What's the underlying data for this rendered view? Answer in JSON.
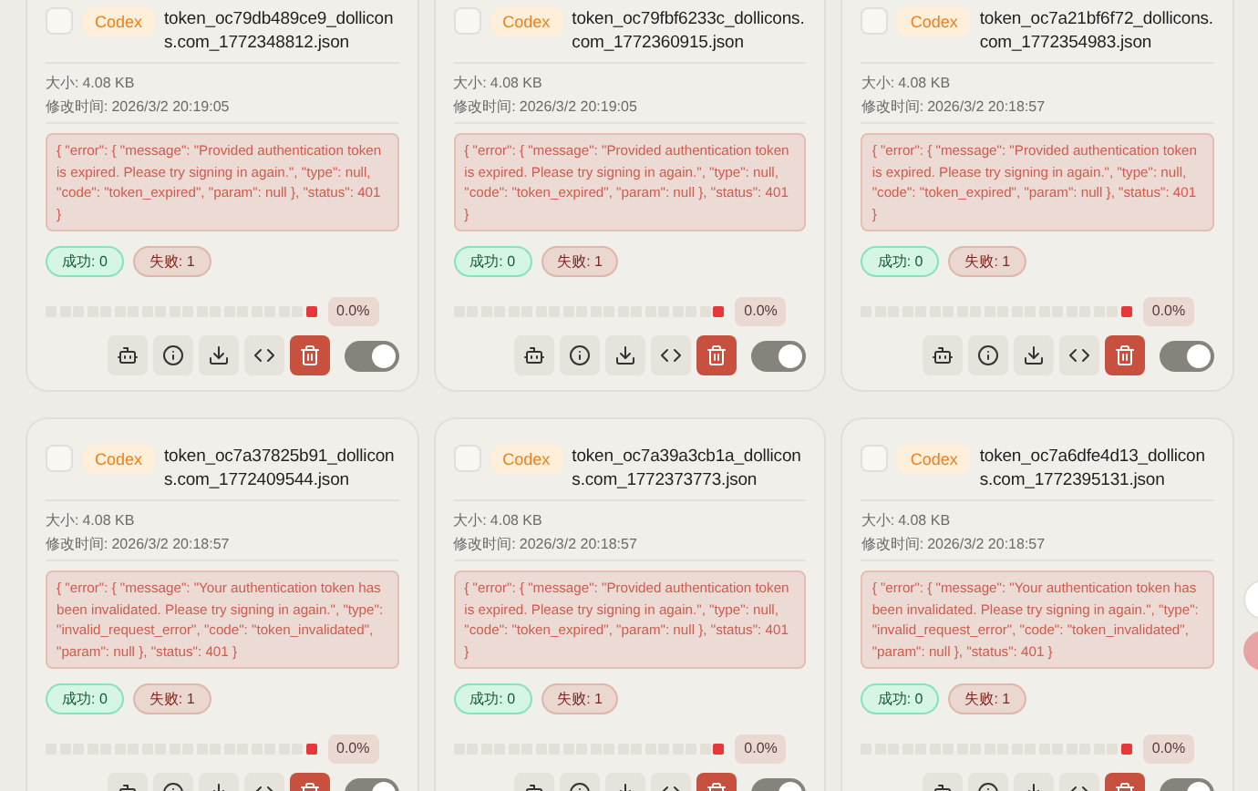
{
  "cards": [
    {
      "checked": false,
      "badge": "Codex",
      "filename": "token_oc79db489ce9_dollicons.com_1772348812.json",
      "size_label": "大小:",
      "size": "4.08 KB",
      "time_label": "修改时间:",
      "time": "2026/3/2 20:19:05",
      "error": "{ \"error\": { \"message\": \"Provided authentication token is expired. Please try signing in again.\", \"type\": null, \"code\": \"token_expired\", \"param\": null }, \"status\": 401 }",
      "success": "成功: 0",
      "fail": "失败: 1",
      "segments": [
        {
          "kind": "empty"
        },
        {
          "kind": "empty"
        },
        {
          "kind": "empty"
        },
        {
          "kind": "empty"
        },
        {
          "kind": "empty"
        },
        {
          "kind": "empty"
        },
        {
          "kind": "empty"
        },
        {
          "kind": "empty"
        },
        {
          "kind": "empty"
        },
        {
          "kind": "empty"
        },
        {
          "kind": "empty"
        },
        {
          "kind": "empty"
        },
        {
          "kind": "empty"
        },
        {
          "kind": "empty"
        },
        {
          "kind": "empty"
        },
        {
          "kind": "empty"
        },
        {
          "kind": "empty"
        },
        {
          "kind": "empty"
        },
        {
          "kind": "empty"
        },
        {
          "kind": "fail"
        }
      ],
      "percent": "0.0%",
      "enabled": true
    },
    {
      "checked": false,
      "badge": "Codex",
      "filename": "token_oc79fbf6233c_dollicons.com_1772360915.json",
      "size_label": "大小:",
      "size": "4.08 KB",
      "time_label": "修改时间:",
      "time": "2026/3/2 20:19:05",
      "error": "{ \"error\": { \"message\": \"Provided authentication token is expired. Please try signing in again.\", \"type\": null, \"code\": \"token_expired\", \"param\": null }, \"status\": 401 }",
      "success": "成功: 0",
      "fail": "失败: 1",
      "segments": [
        {
          "kind": "empty"
        },
        {
          "kind": "empty"
        },
        {
          "kind": "empty"
        },
        {
          "kind": "empty"
        },
        {
          "kind": "empty"
        },
        {
          "kind": "empty"
        },
        {
          "kind": "empty"
        },
        {
          "kind": "empty"
        },
        {
          "kind": "empty"
        },
        {
          "kind": "empty"
        },
        {
          "kind": "empty"
        },
        {
          "kind": "empty"
        },
        {
          "kind": "empty"
        },
        {
          "kind": "empty"
        },
        {
          "kind": "empty"
        },
        {
          "kind": "empty"
        },
        {
          "kind": "empty"
        },
        {
          "kind": "empty"
        },
        {
          "kind": "empty"
        },
        {
          "kind": "fail"
        }
      ],
      "percent": "0.0%",
      "enabled": true
    },
    {
      "checked": false,
      "badge": "Codex",
      "filename": "token_oc7a21bf6f72_dollicons.com_1772354983.json",
      "size_label": "大小:",
      "size": "4.08 KB",
      "time_label": "修改时间:",
      "time": "2026/3/2 20:18:57",
      "error": "{ \"error\": { \"message\": \"Provided authentication token is expired. Please try signing in again.\", \"type\": null, \"code\": \"token_expired\", \"param\": null }, \"status\": 401 }",
      "success": "成功: 0",
      "fail": "失败: 1",
      "segments": [
        {
          "kind": "empty"
        },
        {
          "kind": "empty"
        },
        {
          "kind": "empty"
        },
        {
          "kind": "empty"
        },
        {
          "kind": "empty"
        },
        {
          "kind": "empty"
        },
        {
          "kind": "empty"
        },
        {
          "kind": "empty"
        },
        {
          "kind": "empty"
        },
        {
          "kind": "empty"
        },
        {
          "kind": "empty"
        },
        {
          "kind": "empty"
        },
        {
          "kind": "empty"
        },
        {
          "kind": "empty"
        },
        {
          "kind": "empty"
        },
        {
          "kind": "empty"
        },
        {
          "kind": "empty"
        },
        {
          "kind": "empty"
        },
        {
          "kind": "empty"
        },
        {
          "kind": "fail"
        }
      ],
      "percent": "0.0%",
      "enabled": true
    },
    {
      "checked": false,
      "badge": "Codex",
      "filename": "token_oc7a37825b91_dollicons.com_1772409544.json",
      "size_label": "大小:",
      "size": "4.08 KB",
      "time_label": "修改时间:",
      "time": "2026/3/2 20:18:57",
      "error": "{ \"error\": { \"message\": \"Your authentication token has been invalidated. Please try signing in again.\", \"type\": \"invalid_request_error\", \"code\": \"token_invalidated\", \"param\": null }, \"status\": 401 }",
      "success": "成功: 0",
      "fail": "失败: 1",
      "segments": [
        {
          "kind": "empty"
        },
        {
          "kind": "empty"
        },
        {
          "kind": "empty"
        },
        {
          "kind": "empty"
        },
        {
          "kind": "empty"
        },
        {
          "kind": "empty"
        },
        {
          "kind": "empty"
        },
        {
          "kind": "empty"
        },
        {
          "kind": "empty"
        },
        {
          "kind": "empty"
        },
        {
          "kind": "empty"
        },
        {
          "kind": "empty"
        },
        {
          "kind": "empty"
        },
        {
          "kind": "empty"
        },
        {
          "kind": "empty"
        },
        {
          "kind": "empty"
        },
        {
          "kind": "empty"
        },
        {
          "kind": "empty"
        },
        {
          "kind": "empty"
        },
        {
          "kind": "fail"
        }
      ],
      "percent": "0.0%",
      "enabled": true
    },
    {
      "checked": false,
      "badge": "Codex",
      "filename": "token_oc7a39a3cb1a_dollicons.com_1772373773.json",
      "size_label": "大小:",
      "size": "4.08 KB",
      "time_label": "修改时间:",
      "time": "2026/3/2 20:18:57",
      "error": "{ \"error\": { \"message\": \"Provided authentication token is expired. Please try signing in again.\", \"type\": null, \"code\": \"token_expired\", \"param\": null }, \"status\": 401 }",
      "success": "成功: 0",
      "fail": "失败: 1",
      "segments": [
        {
          "kind": "empty"
        },
        {
          "kind": "empty"
        },
        {
          "kind": "empty"
        },
        {
          "kind": "empty"
        },
        {
          "kind": "empty"
        },
        {
          "kind": "empty"
        },
        {
          "kind": "empty"
        },
        {
          "kind": "empty"
        },
        {
          "kind": "empty"
        },
        {
          "kind": "empty"
        },
        {
          "kind": "empty"
        },
        {
          "kind": "empty"
        },
        {
          "kind": "empty"
        },
        {
          "kind": "empty"
        },
        {
          "kind": "empty"
        },
        {
          "kind": "empty"
        },
        {
          "kind": "empty"
        },
        {
          "kind": "empty"
        },
        {
          "kind": "empty"
        },
        {
          "kind": "fail"
        }
      ],
      "percent": "0.0%",
      "enabled": true
    },
    {
      "checked": false,
      "badge": "Codex",
      "filename": "token_oc7a6dfe4d13_dollicons.com_1772395131.json",
      "size_label": "大小:",
      "size": "4.08 KB",
      "time_label": "修改时间:",
      "time": "2026/3/2 20:18:57",
      "error": "{ \"error\": { \"message\": \"Your authentication token has been invalidated. Please try signing in again.\", \"type\": \"invalid_request_error\", \"code\": \"token_invalidated\", \"param\": null }, \"status\": 401 }",
      "success": "成功: 0",
      "fail": "失败: 1",
      "segments": [
        {
          "kind": "empty"
        },
        {
          "kind": "empty"
        },
        {
          "kind": "empty"
        },
        {
          "kind": "empty"
        },
        {
          "kind": "empty"
        },
        {
          "kind": "empty"
        },
        {
          "kind": "empty"
        },
        {
          "kind": "empty"
        },
        {
          "kind": "empty"
        },
        {
          "kind": "empty"
        },
        {
          "kind": "empty"
        },
        {
          "kind": "empty"
        },
        {
          "kind": "empty"
        },
        {
          "kind": "empty"
        },
        {
          "kind": "empty"
        },
        {
          "kind": "empty"
        },
        {
          "kind": "empty"
        },
        {
          "kind": "empty"
        },
        {
          "kind": "empty"
        },
        {
          "kind": "fail"
        }
      ],
      "percent": "0.0%",
      "enabled": true
    }
  ]
}
